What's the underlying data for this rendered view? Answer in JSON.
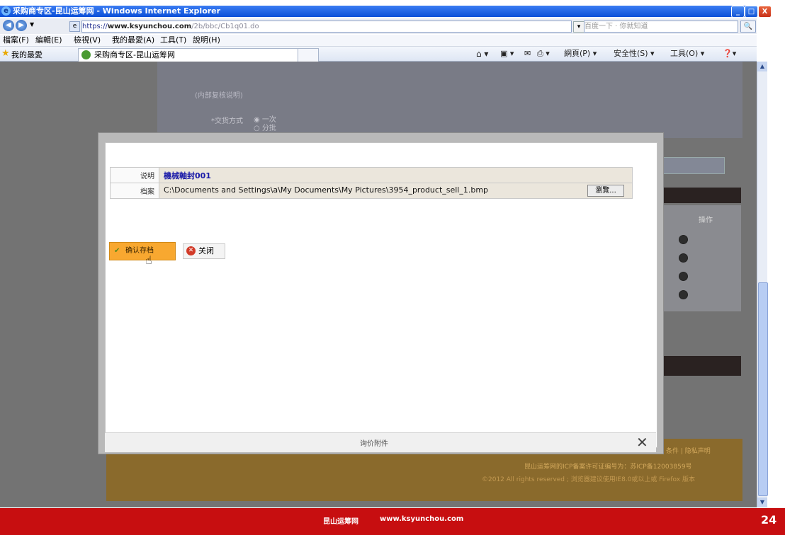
{
  "window": {
    "title": "采购商专区-昆山运筹网 - Windows Internet Explorer",
    "buttons": [
      "_",
      "□",
      "X"
    ]
  },
  "address_bar": {
    "url_scheme": "https://",
    "url_host": "www.ksyunchou.com",
    "url_path": "/2b/bbc/Cb1q01.do",
    "search_placeholder": "百度一下 · 你就知道",
    "search_go": "🔍"
  },
  "menu": [
    "檔案(F)",
    "編輯(E)",
    "檢視(V)",
    "我的最愛(A)",
    "工具(T)",
    "說明(H)"
  ],
  "favorites_bar": {
    "label": "我的最愛",
    "tab_label": "采购商专区-昆山运筹网",
    "commands": [
      "網頁(P) ▾",
      "安全性(S) ▾",
      "工具(O) ▾"
    ]
  },
  "background_page": {
    "label_internal": "(内部复核说明)",
    "label_delivery": "*交货方式",
    "option1": "一次",
    "option2": "分批",
    "table_header": "操作",
    "footer_line1": "条件 | 隐私声明",
    "footer_line2": "昆山运筹网的ICP备案许可证编号为：苏ICP备12003859号",
    "footer_line3": "©2012 All rights reserved ; 浏览器建议使用IE8.0或以上或 Firefox 版本"
  },
  "modal": {
    "title": "询价附件",
    "desc_label": "说明",
    "desc_value": "機械軸封001",
    "file_label": "档案",
    "file_value": "C:\\Documents and Settings\\a\\My Documents\\My Pictures\\3954_product_sell_1.bmp",
    "browse_label": "瀏覽...",
    "save_label": "确认存档",
    "close_label": "关闭",
    "close_x": "✕"
  },
  "banner": {
    "site_name": "昆山运筹网",
    "site_url": "www.ksyunchou.com",
    "page_number": "24"
  },
  "colors": {
    "banner": "#c70e10",
    "save_button": "#f8a830",
    "titlebar": "#0a4fd8"
  }
}
